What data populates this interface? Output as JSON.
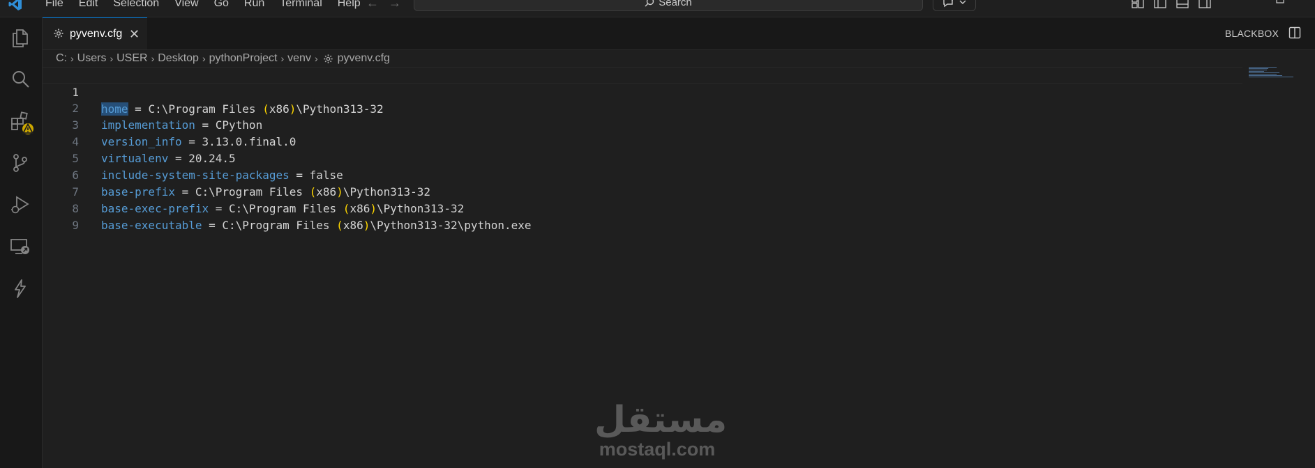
{
  "menu": [
    "File",
    "Edit",
    "Selection",
    "View",
    "Go",
    "Run",
    "Terminal",
    "Help"
  ],
  "search": {
    "placeholder": "Search"
  },
  "tab": {
    "label": "pyvenv.cfg",
    "close": "✕"
  },
  "panel_label": "BLACKBOX",
  "breadcrumb": [
    "C:",
    "Users",
    "USER",
    "Desktop",
    "pythonProject",
    "venv",
    "pyvenv.cfg"
  ],
  "editor": {
    "lines": [
      {
        "num": "1",
        "key": "home",
        "eq": " = ",
        "v1": "C:\\Program Files ",
        "p1": "(",
        "v2": "x86",
        "p2": ")",
        "v3": "\\Python313-32"
      },
      {
        "num": "2",
        "key": "implementation",
        "eq": " = ",
        "v1": "CPython",
        "p1": "",
        "v2": "",
        "p2": "",
        "v3": ""
      },
      {
        "num": "3",
        "key": "version_info",
        "eq": " = ",
        "v1": "3.13.0.final.0",
        "p1": "",
        "v2": "",
        "p2": "",
        "v3": ""
      },
      {
        "num": "4",
        "key": "virtualenv",
        "eq": " = ",
        "v1": "20.24.5",
        "p1": "",
        "v2": "",
        "p2": "",
        "v3": ""
      },
      {
        "num": "5",
        "key": "include-system-site-packages",
        "eq": " = ",
        "v1": "false",
        "p1": "",
        "v2": "",
        "p2": "",
        "v3": ""
      },
      {
        "num": "6",
        "key": "base-prefix",
        "eq": " = ",
        "v1": "C:\\Program Files ",
        "p1": "(",
        "v2": "x86",
        "p2": ")",
        "v3": "\\Python313-32"
      },
      {
        "num": "7",
        "key": "base-exec-prefix",
        "eq": " = ",
        "v1": "C:\\Program Files ",
        "p1": "(",
        "v2": "x86",
        "p2": ")",
        "v3": "\\Python313-32"
      },
      {
        "num": "8",
        "key": "base-executable",
        "eq": " = ",
        "v1": "C:\\Program Files ",
        "p1": "(",
        "v2": "x86",
        "p2": ")",
        "v3": "\\Python313-32\\python.exe"
      },
      {
        "num": "9",
        "key": "",
        "eq": "",
        "v1": "",
        "p1": "",
        "v2": "",
        "p2": "",
        "v3": ""
      }
    ]
  },
  "watermark": {
    "arabic": "مستقل",
    "latin": "mostaql.com"
  },
  "colors": {
    "accent": "#0078d4",
    "key": "#569cd6",
    "paren": "#ffd700",
    "warning": "#cca700"
  },
  "icons": [
    "vscode-logo-icon",
    "files-icon",
    "search-icon",
    "extensions-icon",
    "warning-icon",
    "source-control-icon",
    "run-debug-icon",
    "remote-explorer-icon",
    "lightning-icon",
    "gear-icon",
    "close-icon",
    "copilot-icon",
    "chevron-down-icon",
    "split-editor-icon"
  ]
}
